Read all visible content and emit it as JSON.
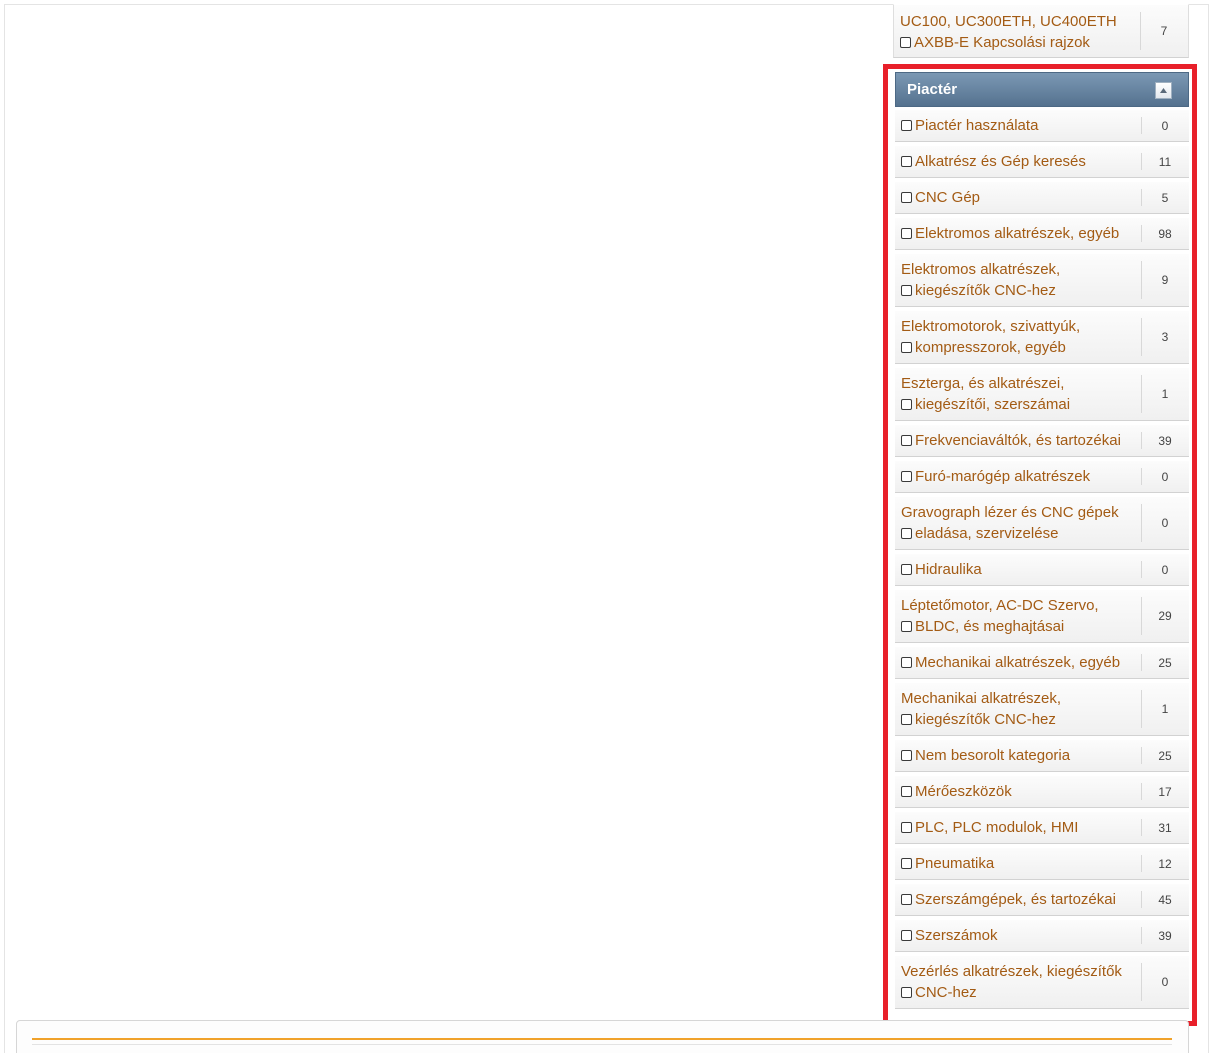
{
  "prev_item": {
    "line1": "UC100, UC300ETH, UC400ETH",
    "line2": "AXBB-E Kapcsolási rajzok",
    "count": "7"
  },
  "sidebar": {
    "title": "Piactér",
    "collapse_icon": "chevron-up-icon",
    "items": [
      {
        "line1": "",
        "line2": "Piactér használata",
        "count": "0"
      },
      {
        "line1": "",
        "line2": "Alkatrész és Gép keresés",
        "count": "11"
      },
      {
        "line1": "",
        "line2": "CNC Gép",
        "count": "5"
      },
      {
        "line1": "",
        "line2": "Elektromos alkatrészek, egyéb",
        "count": "98"
      },
      {
        "line1": "Elektromos alkatrészek,",
        "line2": "kiegészítők CNC-hez",
        "count": "9"
      },
      {
        "line1": "Elektromotorok, szivattyúk,",
        "line2": "kompresszorok, egyéb",
        "count": "3"
      },
      {
        "line1": "Eszterga, és alkatrészei,",
        "line2": "kiegészítői, szerszámai",
        "count": "1"
      },
      {
        "line1": "",
        "line2": "Frekvenciaváltók, és tartozékai",
        "count": "39"
      },
      {
        "line1": "",
        "line2": "Furó-marógép alkatrészek",
        "count": "0"
      },
      {
        "line1": "Gravograph lézer és CNC gépek",
        "line2": "eladása, szervizelése",
        "count": "0"
      },
      {
        "line1": "",
        "line2": "Hidraulika",
        "count": "0"
      },
      {
        "line1": "Léptetőmotor, AC-DC Szervo,",
        "line2": "BLDC, és meghajtásai",
        "count": "29"
      },
      {
        "line1": "",
        "line2": "Mechanikai alkatrészek, egyéb",
        "count": "25"
      },
      {
        "line1": "Mechanikai alkatrészek,",
        "line2": "kiegészítők CNC-hez",
        "count": "1"
      },
      {
        "line1": "",
        "line2": "Nem besorolt kategoria",
        "count": "25"
      },
      {
        "line1": "",
        "line2": "Mérőeszközök",
        "count": "17"
      },
      {
        "line1": "",
        "line2": "PLC, PLC modulok, HMI",
        "count": "31"
      },
      {
        "line1": "",
        "line2": "Pneumatika",
        "count": "12"
      },
      {
        "line1": "",
        "line2": "Szerszámgépek, és tartozékai",
        "count": "45"
      },
      {
        "line1": "",
        "line2": "Szerszámok",
        "count": "39"
      },
      {
        "line1": "Vezérlés alkatrészek, kiegészítők",
        "line2": "CNC-hez",
        "count": "0"
      }
    ]
  },
  "colors": {
    "link": "#a35b14",
    "header": "#5f7d99",
    "highlight": "#e8202a",
    "accent_bar": "#f0a22a"
  }
}
